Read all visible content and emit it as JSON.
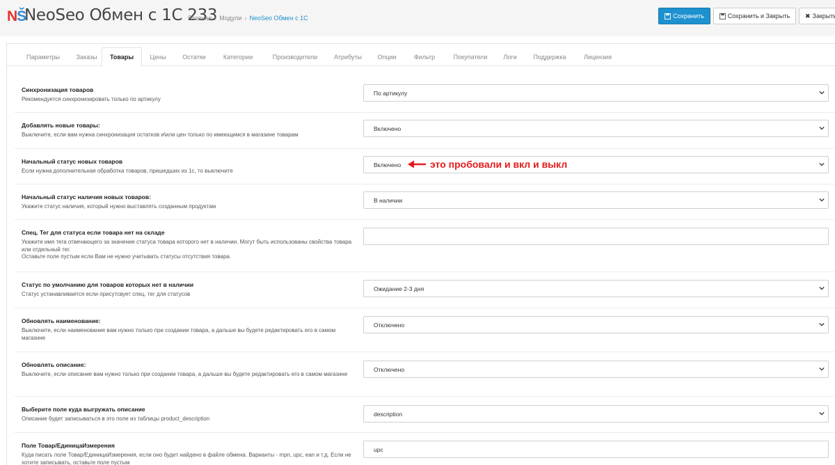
{
  "header": {
    "title": "NeoSeo Обмен с 1С 233",
    "breadcrumb": [
      "Главная",
      "Модули",
      "NeoSeo Обмен с 1С"
    ],
    "buttons": {
      "save": "Сохранить",
      "save_close": "Сохранить и Закрыть",
      "close": "Закрыть"
    }
  },
  "tabs": [
    "Параметры",
    "Заказы",
    "Товары",
    "Цены",
    "Остатки",
    "Категории",
    "Производители",
    "Атрибуты",
    "Опции",
    "Фильтр",
    "Покупатели",
    "Логи",
    "Поддержка",
    "Лицензия"
  ],
  "active_tab": "Товары",
  "settings": [
    {
      "title": "Синхронизация товаров",
      "help": "Рекомендуется синхронизировать только по артикулу",
      "value": "По артикулу"
    },
    {
      "title": "Добавлять новые товары:",
      "help": "Выключите, если вам нужна синхронизация остатков и\\или цен только по имеющимся в магазине товарам",
      "value": "Включено"
    },
    {
      "title": "Начальный статус новых товаров",
      "help": "Если нужна дополнительная обработка товаров, пришедших из 1с, то выключите",
      "value": "Включено"
    },
    {
      "title": "Начальный статус наличия новых товаров:",
      "help": "Укажите статус наличия, который нужно выставлять созданным продуктам",
      "value": "В наличии"
    },
    {
      "title": "Спец. Тег для статуса если товара нет на складе",
      "help": "Укажите имя тега отвечающего за значение статуса товара которого нет в наличии. Могут быть использованы свойства товара или отдельный тег.",
      "help2": "Оставьте поле пустым если Вам не нужно учитывать статусы отсутствия товара.",
      "value": ""
    },
    {
      "title": "Статус по умолчанию для товаров которых нет в наличии",
      "help": "Статус устанавливается если присутсвует спец. тег для статусов",
      "value": "Ожидание 2-3 дня"
    },
    {
      "title": "Обновлять наименование:",
      "help": "Выключите, если наименование вам нужно только при создании товара, а дальше вы будете редактировать его в самом магазине",
      "value": "Отключено"
    },
    {
      "title": "Обновлять описание:",
      "help": "Выключите, если описание вам нужно только при создании товара, а дальше вы будете редактировать его в самом магазине",
      "value": "Отключено"
    },
    {
      "title": "Выберите поле куда выгружать описание",
      "help": "Описание будет записываться в это поле из таблицы product_description",
      "value": "description"
    },
    {
      "title": "Поле Товар/ЕдиницаИзмерения",
      "help": "Куда писать поле Товар/ЕдиницаИзмерения, если оно будет найдено в файле обмена. Варианты - mpn, upc, ean и т.д. Если не хотите записывать, оставьте поле пустым",
      "value": "upc"
    }
  ],
  "annotation": {
    "text": "это пробовали и вкл и выкл",
    "color": "#e31b1b"
  },
  "colors": {
    "primary": "#1e91cf",
    "logo_red": "#e7322d",
    "logo_blue": "#2f8bd6"
  }
}
